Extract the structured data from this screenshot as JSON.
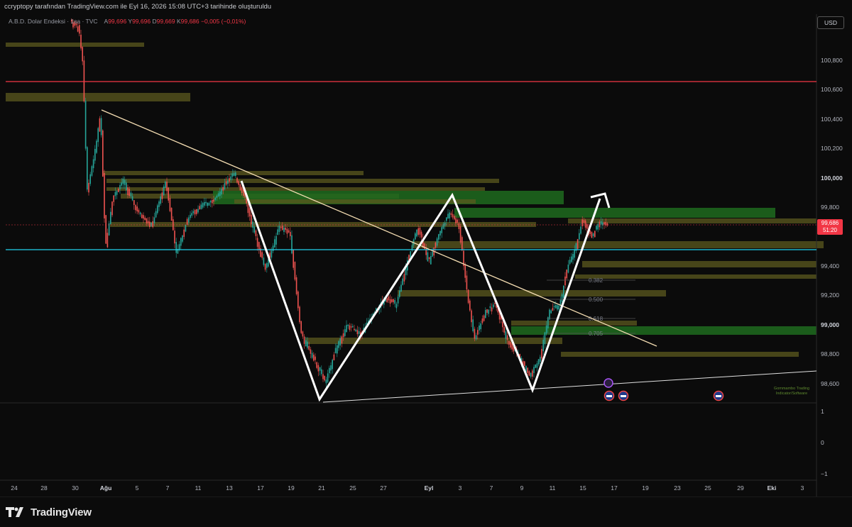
{
  "header": {
    "caption": "ccryptopy tarafından TradingView.com ile Eyl 16, 2026 15:08 UTC+3 tarihinde oluşturuldu"
  },
  "legend": {
    "symbol": "A.B.D. Dolar Endeksi · 1sa · TVC",
    "open_label": "A",
    "open": "99,696",
    "high_label": "Y",
    "high": "99,696",
    "low_label": "D",
    "low": "99,669",
    "close_label": "K",
    "close": "99,686",
    "change": "−0,005 (−0,01%)"
  },
  "currency_button": "USD",
  "price_tag": {
    "price": "99,686",
    "countdown": "51:20"
  },
  "price_axis": [
    "100,800",
    "100,600",
    "100,400",
    "100,200",
    "100,000",
    "99,800",
    "99,400",
    "99,200",
    "99,000",
    "98,800",
    "98,600"
  ],
  "indicator_axis": [
    "1",
    "0",
    "−1"
  ],
  "time_axis": [
    "24",
    "28",
    "30",
    "Ağu",
    "5",
    "7",
    "11",
    "13",
    "17",
    "19",
    "21",
    "25",
    "27",
    "Eyl",
    "3",
    "7",
    "9",
    "11",
    "15",
    "17",
    "19",
    "23",
    "25",
    "29",
    "Eki",
    "3"
  ],
  "fib_labels": [
    "0.382",
    "0.500",
    "0.618",
    "0.705"
  ],
  "watermark": "Gommambo Trading Indicator/Software",
  "brand": "TradingView",
  "colors": {
    "background": "#0b0b0b",
    "bull": "#26a69a",
    "bear": "#ef5350",
    "zone_olive": "#5c5a1f",
    "zone_green": "#1e6b1e",
    "resistance_line": "#f23645",
    "support_line": "#22d3ee",
    "trendline": "#f5deb3"
  }
}
